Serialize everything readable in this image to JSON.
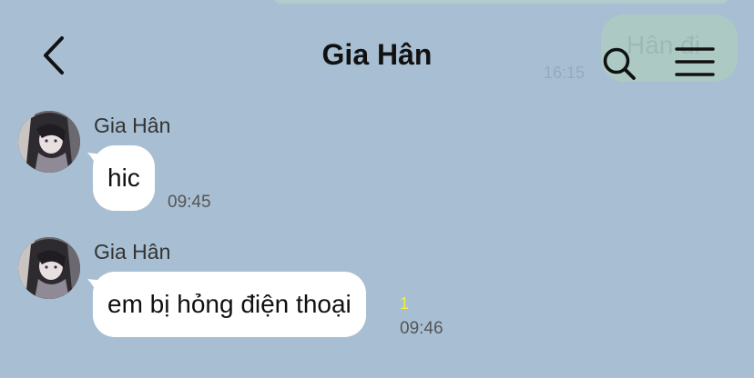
{
  "header": {
    "title": "Gia Hân"
  },
  "background_overlap": {
    "bubble_text": "Hân đi",
    "time": "16:15"
  },
  "messages": [
    {
      "sender": "Gia Hân",
      "text": "hic",
      "time": "09:45"
    },
    {
      "sender": "Gia Hân",
      "text": "em bị hỏng điện thoại",
      "time": "09:46",
      "unread_count": "1"
    }
  ],
  "icons": {
    "back": "chevron-left-icon",
    "search": "search-icon",
    "menu": "hamburger-menu-icon"
  },
  "colors": {
    "background": "#a8bfd3",
    "bubble": "#ffffff",
    "unread": "#f2ee3a"
  }
}
